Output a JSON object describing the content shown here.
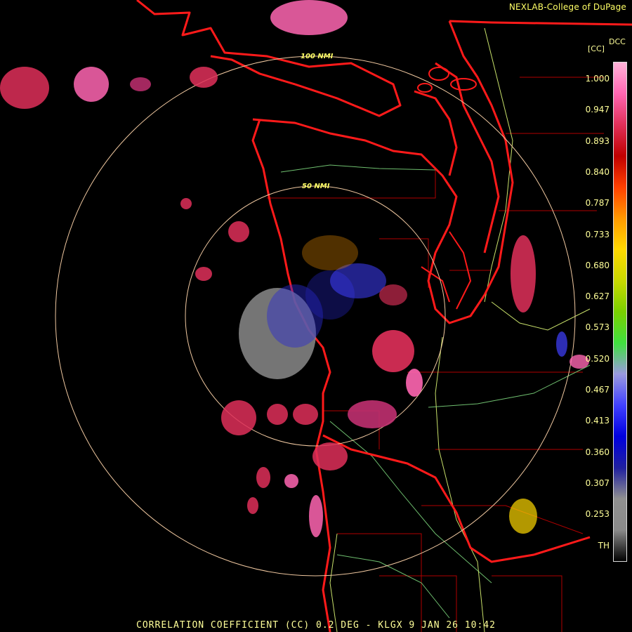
{
  "credit": "NEXLAB-College of DuPage",
  "legend": {
    "title": "DCC",
    "unit": "[CC]",
    "ticks": [
      "1.000",
      "0.947",
      "0.893",
      "0.840",
      "0.787",
      "0.733",
      "0.680",
      "0.627",
      "0.573",
      "0.520",
      "0.467",
      "0.413",
      "0.360",
      "0.307",
      "0.253",
      "TH"
    ]
  },
  "rings": [
    "50 NMI",
    "100 NMI"
  ],
  "footer": "CORRELATION COEFFICIENT (CC) 0.2 DEG - KLGX 9 JAN 26 10:42",
  "colors": {
    "background": "#000000",
    "state_border": "#ff1a1a",
    "county_border": "#b00000",
    "highway": "#c8e06a",
    "river": "#6fbf6f",
    "range_ring": "#f0c8a0",
    "label_text": "#ffff99"
  },
  "colorbar_stops": [
    "#ffb3d9",
    "#ff66b2",
    "#e0305a",
    "#c00000",
    "#ff4000",
    "#ff9a00",
    "#ffd800",
    "#c8d800",
    "#7ad000",
    "#40e040",
    "#9a9ae0",
    "#4040ff",
    "#0000e0",
    "#2020a0",
    "#909090",
    "#8a8a8a",
    "#000000"
  ]
}
